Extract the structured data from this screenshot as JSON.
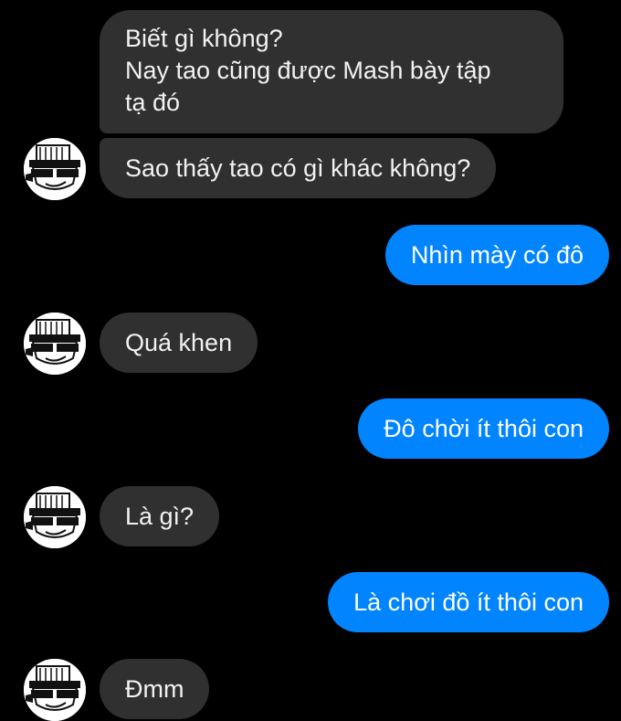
{
  "conversation": {
    "messages": [
      {
        "sender": "them",
        "lines": [
          "Biết gì không?",
          "Nay tao cũng được Mash bày tập",
          "tạ đó"
        ]
      },
      {
        "sender": "them",
        "text": "Sao thấy tao có gì khác không?"
      },
      {
        "sender": "me",
        "text": "Nhìn mày có đô"
      },
      {
        "sender": "them",
        "text": "Quá khen"
      },
      {
        "sender": "me",
        "text": "Đô chời ít thôi con"
      },
      {
        "sender": "them",
        "text": "Là gì?"
      },
      {
        "sender": "me",
        "text": "Là chơi đồ ít thôi con"
      },
      {
        "sender": "them",
        "text": "Đmm"
      }
    ]
  },
  "colors": {
    "background": "#000000",
    "incoming_bubble": "#303030",
    "outgoing_bubble": "#0084ff",
    "text": "#ffffff"
  },
  "icons": {
    "avatar": "contact-avatar-icon"
  }
}
